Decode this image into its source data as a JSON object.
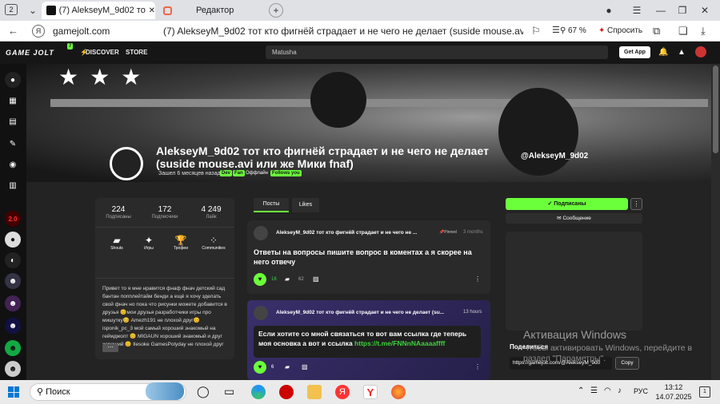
{
  "browser": {
    "tab_counter": "2",
    "tabs": [
      {
        "title": "(7) AlekseyM_9d02 тот кто фигнёй страдает и не чего не делает (suside mouse.avi или же Мики fnaf)"
      },
      {
        "title": "Редактор"
      }
    ],
    "address": {
      "domain": "gamejolt.com",
      "page_title": "(7) AlekseyM_9d02 тот кто фигнёй страдает и не чего не делает (suside mouse.av...",
      "zoom": "67 %",
      "ask_label": "Спросить"
    }
  },
  "gamejolt_header": {
    "logo": "GAME JOLT",
    "logo_badge": "7",
    "discover_label": "DISCOVER",
    "store_label": "STORE",
    "search_value": "Matusha",
    "get_app_label": "Get App"
  },
  "profile": {
    "title": "AlekseyM_9d02 тот кто фигнёй страдает и не чего не делает (suside mouse.avi или же Мики fnaf)",
    "handle": "@AlekseyM_9d02",
    "joined": "Зашел 6 месяцев назад",
    "badges": [
      "Dev",
      "Fan",
      "Оффлайн",
      "Follows you"
    ],
    "stats": [
      {
        "value": "224",
        "label": "Подписаны"
      },
      {
        "value": "172",
        "label": "Подписчики"
      },
      {
        "value": "4 249",
        "label": "Лайк"
      }
    ],
    "links": [
      {
        "icon": "shouts-icon",
        "label": "Shouts"
      },
      {
        "icon": "games-icon",
        "label": "Игры"
      },
      {
        "icon": "trophy-icon",
        "label": "Трофеи"
      },
      {
        "icon": "communities-icon",
        "label": "Communities"
      }
    ],
    "bio": "Привет то я  мне нравится фнаф фнач детский сад бантан попплейтайм бенди а ещё я хочу зделать свой фнач но пока что рисунки можете добавится в друзья 😊мои друзья  разработчики игры про мишутку😊 Amezh191 не плохой друг😊isponik_pc_3 мой самый хороший знакомый на геймджолт 😊 MIGAUN хороший знакомый и друг хороший 😊 Ilesoke GamesPolyday не плохой друг ...",
    "bio_more": "⋯"
  },
  "feed": {
    "tabs": [
      "Посты",
      "Likes"
    ],
    "posts": [
      {
        "author": "AlekseyM_9d02 тот кто фигнёй страдает и не чего не ...",
        "pinned_label": "Pinned",
        "time": "3 months",
        "text": "Ответы на вопросы пишите вопрос в коментах а я скорее на него отвечу",
        "likes": "16",
        "comments": "62"
      },
      {
        "author": "AlekseyM_9d02 тот кто фигнёй страдает и не чего не делает (su...",
        "time": "13 hours",
        "text": "Если хотите со мной связаться то вот вам ссылка где теперь моя основка а вот и ссылка",
        "link": "https://t.me/FNNnNAaaaaffff",
        "likes": "6"
      }
    ]
  },
  "actions": {
    "subscribed_label": "Подписаны",
    "message_label": "Сообщение",
    "share_label": "Поделиться",
    "share_url": "https://gamejolt.com/@AlekseyM_9d0",
    "copy_label": "Copy"
  },
  "windows_watermark": {
    "line1": "Активация Windows",
    "line2": "Чтобы активировать Windows, перейдите в раздел \"Параметры\"."
  },
  "taskbar": {
    "search_placeholder": "Поиск",
    "lang": "РУС",
    "time": "13:12",
    "date": "14.07.2025",
    "notification_count": "1"
  },
  "colors": {
    "accent": "#6bff3b",
    "header_bg": "#161616",
    "page_bg": "#232323",
    "card_bg": "#2a2a2a",
    "post_purple": "#3a2f6b"
  }
}
